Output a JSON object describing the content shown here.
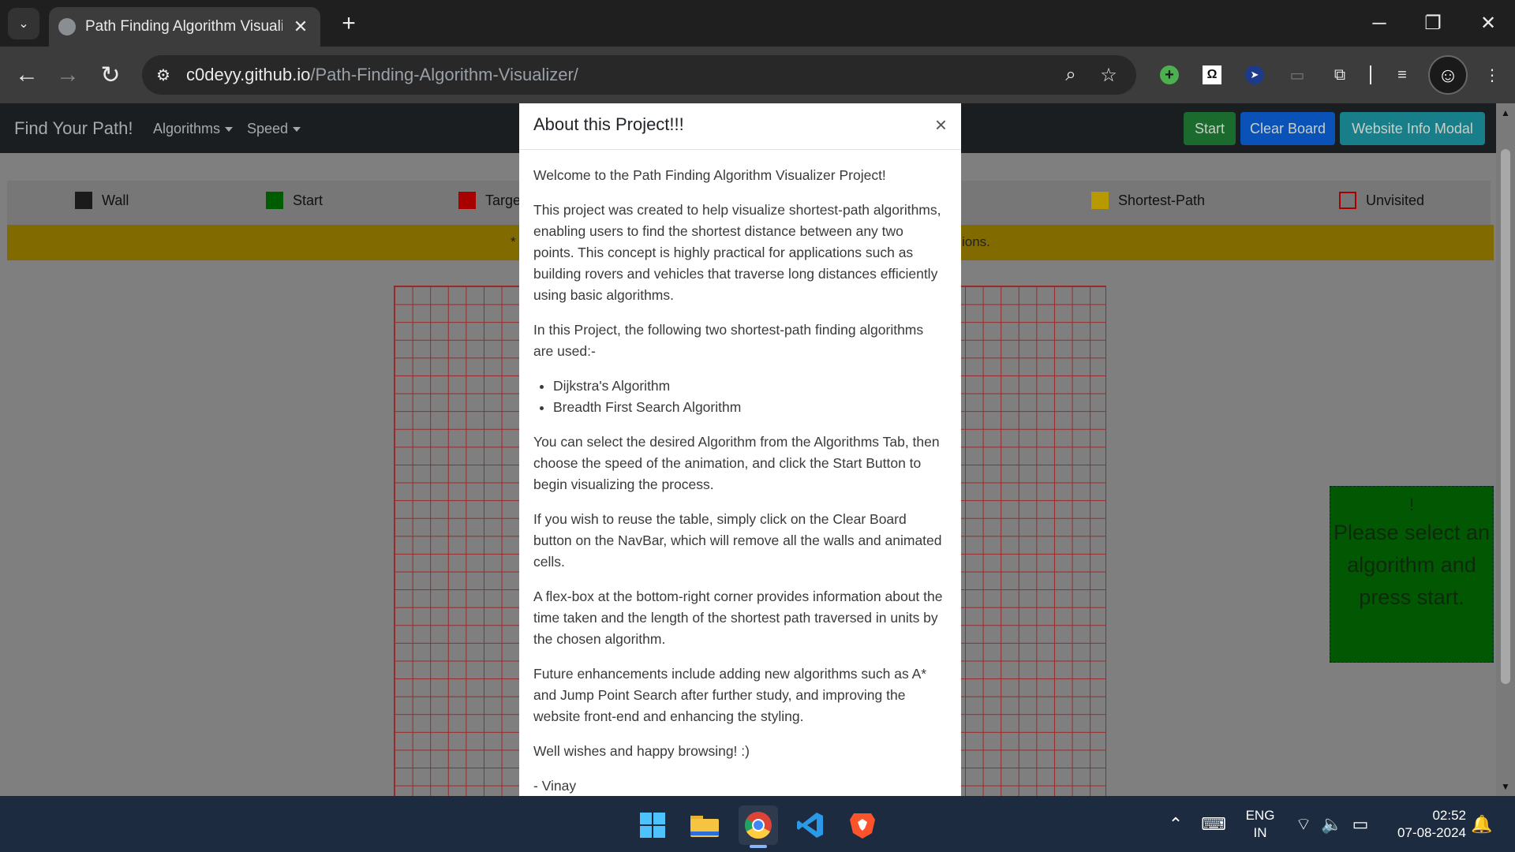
{
  "browser": {
    "tab_title": "Path Finding Algorithm Visualiz",
    "close_glyph": "✕",
    "new_tab_glyph": "+",
    "url_host": "c0deyy.github.io",
    "url_path": "/Path-Finding-Algorithm-Visualizer/",
    "window_controls": {
      "minimize": "─",
      "restore": "❐",
      "close": "✕"
    }
  },
  "navbar": {
    "brand": "Find Your Path!",
    "algorithms": "Algorithms",
    "speed": "Speed",
    "start": "Start",
    "clear_board": "Clear Board",
    "website_info": "Website Info Modal"
  },
  "legend": {
    "wall": "Wall",
    "start": "Start",
    "target": "Targe",
    "shortest_path": "Shortest-Path",
    "unvisited": "Unvisited"
  },
  "banner": {
    "left_fragment": "*",
    "right_fragment": "ions."
  },
  "infobox": {
    "bang": "!",
    "message": "Please select an algorithm and press start."
  },
  "modal": {
    "title": "About this Project!!!",
    "close": "×",
    "p1": "Welcome to the Path Finding Algorithm Visualizer Project!",
    "p2": "This project was created to help visualize shortest-path algorithms, enabling users to find the shortest distance between any two points. This concept is highly practical for applications such as building rovers and vehicles that traverse long distances efficiently using basic algorithms.",
    "p3": "In this Project, the following two shortest-path finding algorithms are used:-",
    "list": [
      "Dijkstra's Algorithm",
      "Breadth First Search Algorithm"
    ],
    "p4": "You can select the desired Algorithm from the Algorithms Tab, then choose the speed of the animation, and click the Start Button to begin visualizing the process.",
    "p5": "If you wish to reuse the table, simply click on the Clear Board button on the NavBar, which will remove all the walls and animated cells.",
    "p6": "A flex-box at the bottom-right corner provides information about the time taken and the length of the shortest path traversed in units by the chosen algorithm.",
    "p7": "Future enhancements include adding new algorithms such as A* and Jump Point Search after further study, and improving the website front-end and enhancing the styling.",
    "p8": "Well wishes and happy browsing! :)",
    "p9": "- Vinay"
  },
  "taskbar": {
    "lang": "ENG",
    "region": "IN",
    "time": "02:52",
    "date": "07-08-2024"
  },
  "colors": {
    "wall": "#1b1b1b",
    "start": "#005c00",
    "target": "#a80000",
    "shortest_path": "#b89a00",
    "unvisited_border": "#a80000",
    "infobox": "#025802",
    "btn_start": "#1c6b2e",
    "btn_clear": "#0a52b8",
    "btn_info": "#177e8a"
  }
}
